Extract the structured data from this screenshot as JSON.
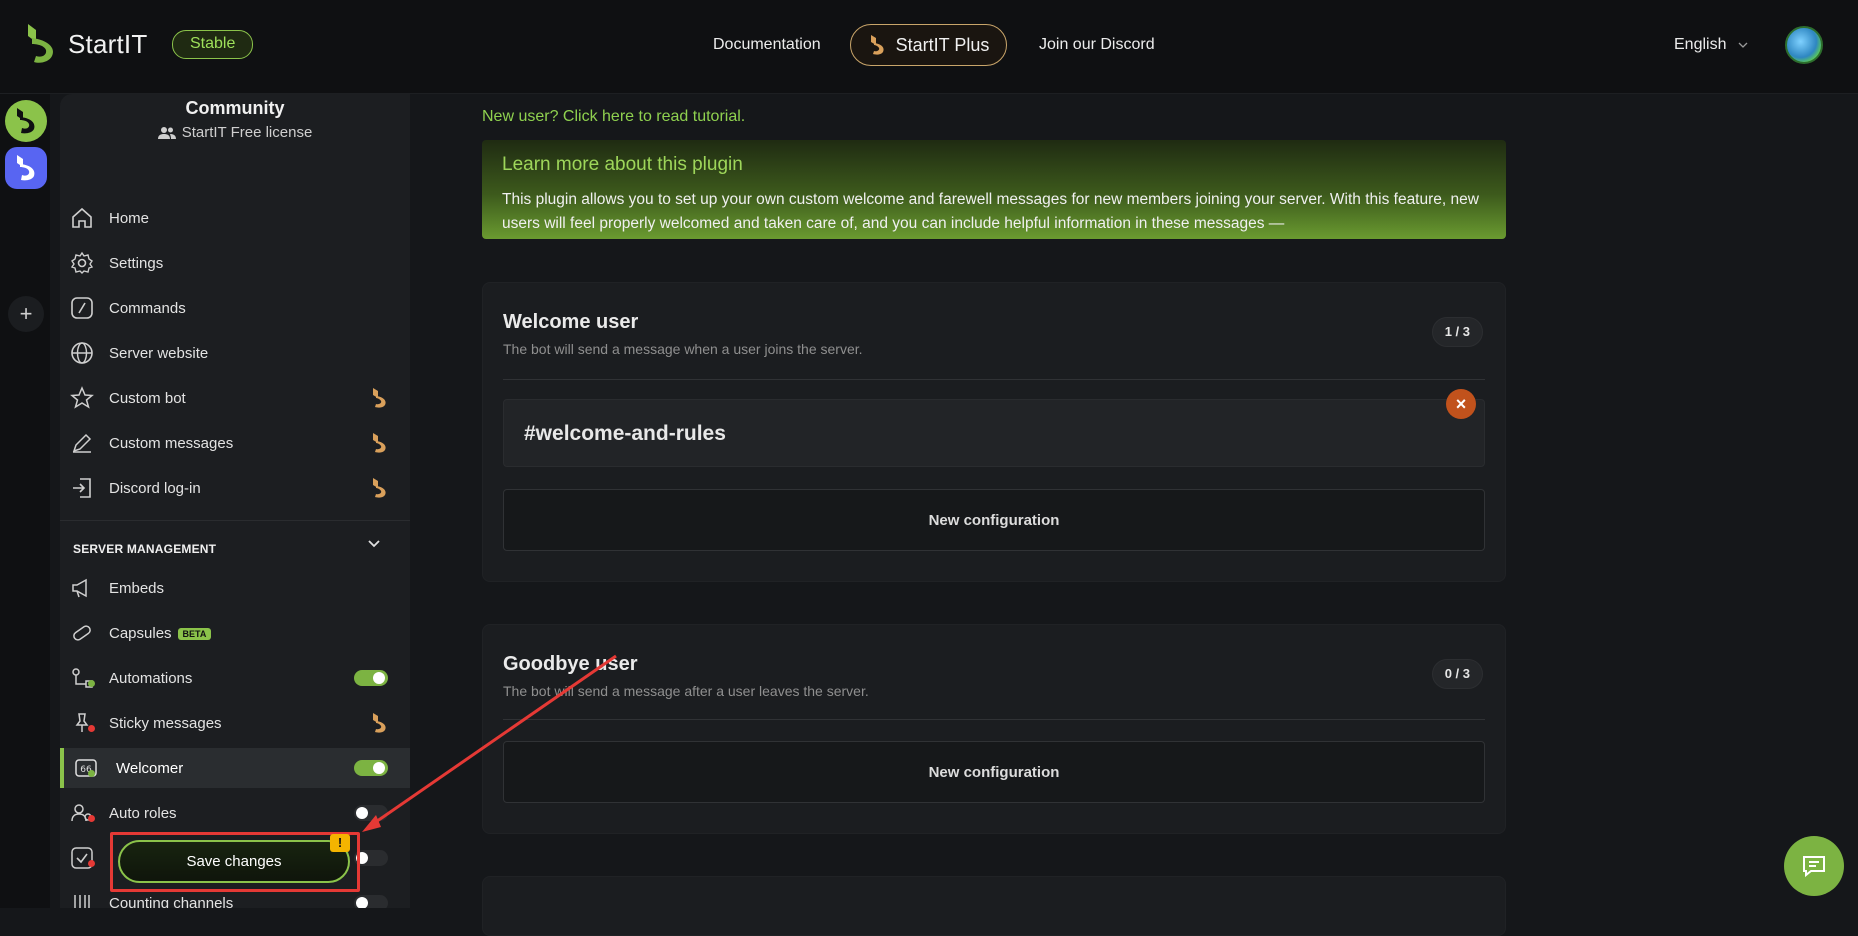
{
  "header": {
    "brand": "StartIT",
    "channel_badge": "Stable",
    "nav": [
      "Documentation",
      "StartIT Plus",
      "Join our Discord"
    ],
    "language": "English"
  },
  "sidebar": {
    "community_name": "Community",
    "license": "StartIT Free license",
    "items": [
      {
        "label": "Home",
        "icon": "home-icon"
      },
      {
        "label": "Settings",
        "icon": "gear-icon"
      },
      {
        "label": "Commands",
        "icon": "slash-command-icon"
      },
      {
        "label": "Server website",
        "icon": "globe-icon"
      },
      {
        "label": "Custom bot",
        "icon": "star-icon",
        "premium": true
      },
      {
        "label": "Custom messages",
        "icon": "pen-icon",
        "premium": true
      },
      {
        "label": "Discord log-in",
        "icon": "login-icon",
        "premium": true
      }
    ],
    "section_title": "SERVER MANAGEMENT",
    "management": [
      {
        "label": "Embeds",
        "icon": "megaphone-icon"
      },
      {
        "label": "Capsules",
        "badge": "BETA",
        "icon": "capsule-icon"
      },
      {
        "label": "Automations",
        "toggle": "on",
        "icon": "automation-icon"
      },
      {
        "label": "Sticky messages",
        "premium": true,
        "icon": "pin-icon"
      },
      {
        "label": "Welcomer",
        "toggle": "on",
        "icon": "welcomer-icon",
        "active": true
      },
      {
        "label": "Auto roles",
        "toggle": "off",
        "icon": "roles-icon"
      },
      {
        "label": "",
        "toggle": "off",
        "icon": "checkbox-icon"
      },
      {
        "label": "Counting channels",
        "toggle": "off",
        "icon": "counting-icon"
      }
    ],
    "save_label": "Save changes",
    "warn_mark": "!"
  },
  "main": {
    "tutorial_link": "New user? Click here to read tutorial.",
    "info_title": "Learn more about this plugin",
    "info_text": "This plugin allows you to set up your own custom welcome and farewell messages for new members joining your server. With this feature, new users will feel properly welcomed and taken care of, and you can include helpful information in these messages —",
    "welcome": {
      "title": "Welcome user",
      "subtitle": "The bot will send a message when a user joins the server.",
      "counter": "1 / 3",
      "channel": "#welcome-and-rules",
      "new_config": "New configuration"
    },
    "goodbye": {
      "title": "Goodbye user",
      "subtitle": "The bot will send a message after a user leaves the server.",
      "counter": "0 / 3",
      "new_config": "New configuration"
    }
  },
  "colors": {
    "accent": "#8bc34a",
    "premium": "#d9a05b",
    "danger": "#e53935",
    "background": "#15171a"
  }
}
